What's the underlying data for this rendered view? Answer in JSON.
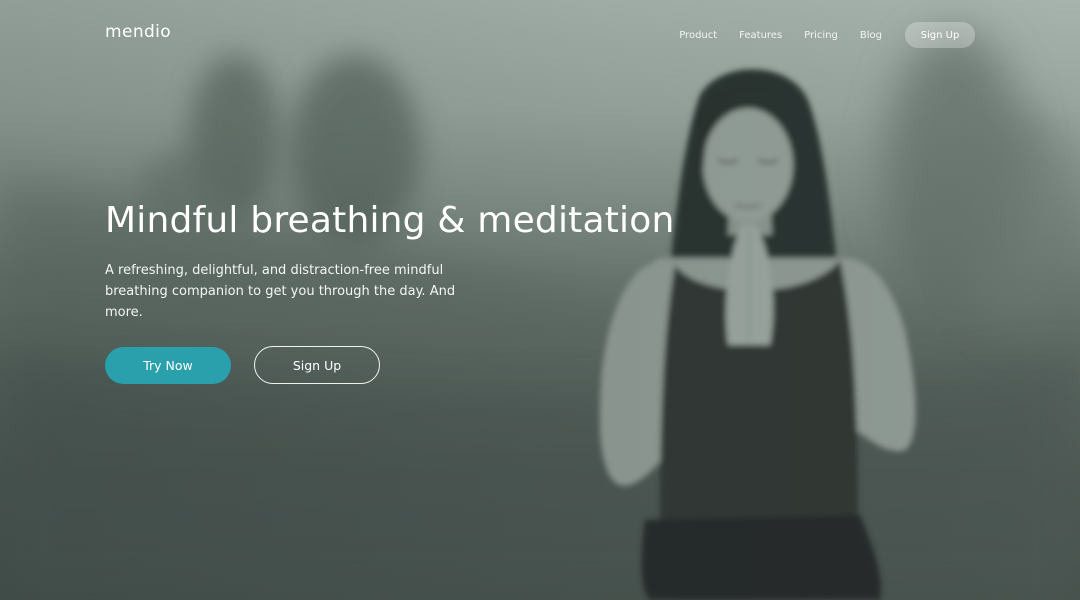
{
  "brand": {
    "logo": "mendio"
  },
  "nav": {
    "links": [
      "Product",
      "Features",
      "Pricing",
      "Blog"
    ],
    "signup_label": "Sign Up"
  },
  "hero": {
    "headline": "Mindful breathing & meditation",
    "subtitle": "A refreshing, delightful, and distraction-free mindful breathing companion to get you through the day. And more.",
    "primary_cta": "Try Now",
    "secondary_cta": "Sign Up"
  },
  "colors": {
    "accent": "#2aa0ac",
    "text": "#ffffff",
    "overlay": "#6f7d77"
  }
}
